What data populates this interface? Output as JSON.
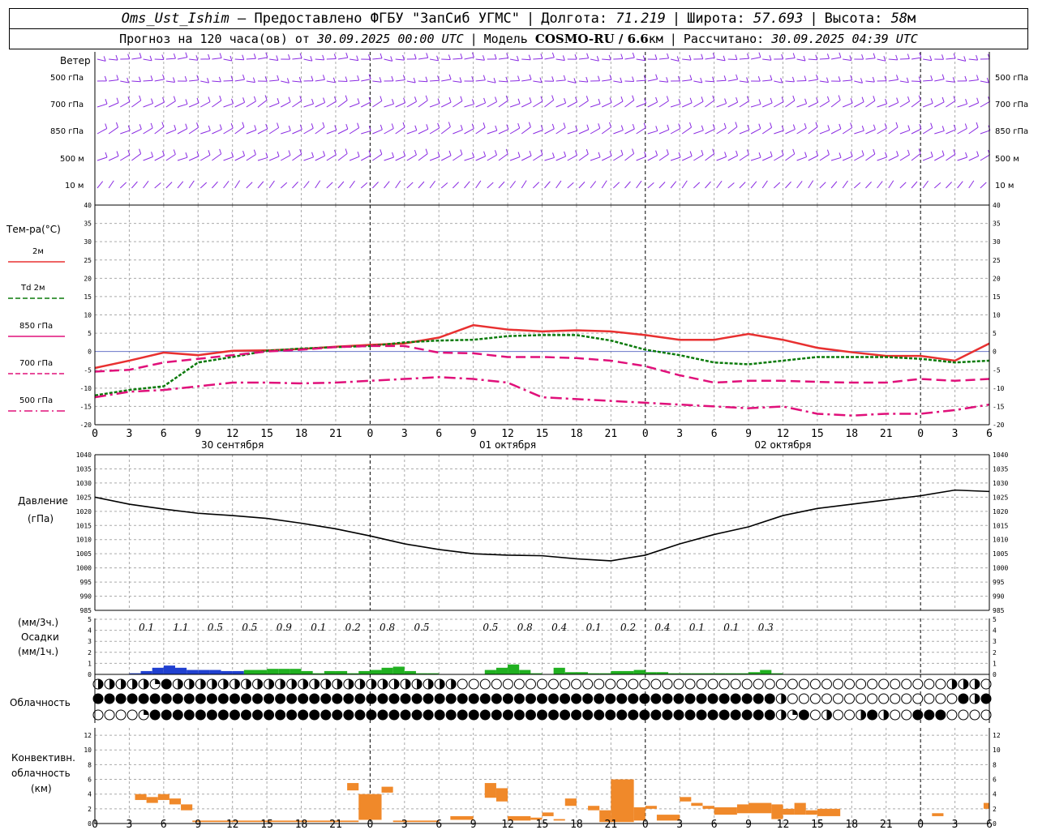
{
  "header": {
    "station": "Oms_Ust_Ishim",
    "provided": "– Предоставлено ФГБУ \"ЗапСиб УГМС\"",
    "lon_label": "Долгота:",
    "lon_value": "71.219",
    "lat_label": "Широта:",
    "lat_value": "57.693",
    "alt_label": "Высота:",
    "alt_value": "58",
    "alt_unit": "м",
    "forecast_prefix": "Прогноз на 120 часа(ов) от",
    "forecast_time": "30.09.2025 00:00 UTC",
    "model_label": "Модель",
    "model_name": "COSMO-RU / 6.6",
    "model_unit": "км",
    "calc_label": "Рассчитано:",
    "calc_time": "30.09.2025 04:39 UTC"
  },
  "wind_panel": {
    "title": "Ветер",
    "levels": [
      "500 гПа",
      "700 гПа",
      "850 гПа",
      "500 м",
      "10 м"
    ],
    "colors": {
      "barb": "#8a2be2",
      "stem": "#6a0dad"
    }
  },
  "temp_panel": {
    "title": "Тем-ра(°С)",
    "legend": [
      {
        "label": "2м",
        "color": "#e83030",
        "style": "solid"
      },
      {
        "label": "Td  2м",
        "color": "#0a7a0a",
        "style": "dashed"
      },
      {
        "label": "850 гПа",
        "color": "#e0107a",
        "style": "solid"
      },
      {
        "label": "700 гПа",
        "color": "#e0107a",
        "style": "dashed"
      },
      {
        "label": "500 гПа",
        "color": "#e0107a",
        "style": "dashdot"
      }
    ],
    "yticks": [
      "40",
      "35",
      "30",
      "25",
      "20",
      "15",
      "10",
      "5",
      "0",
      "-5",
      "-10",
      "-15",
      "-20"
    ]
  },
  "pressure_panel": {
    "title": "Давление",
    "unit": "(гПа)",
    "yticks": [
      "1040",
      "1035",
      "1030",
      "1025",
      "1020",
      "1015",
      "1010",
      "1005",
      "1000",
      "995",
      "990",
      "985"
    ]
  },
  "precip_panel": {
    "unit3": "(мм/3ч.)",
    "title": "Осадки",
    "unit1": "(мм/1ч.)",
    "yticks": [
      "5",
      "4",
      "3",
      "2",
      "1",
      "0"
    ],
    "totals": [
      "0.1",
      "1.1",
      "0.5",
      "0.5",
      "0.9",
      "0.1",
      "0.2",
      "0.8",
      "0.5",
      "0.5",
      "0.8",
      "0.4",
      "0.1",
      "0.2",
      "0.4",
      "0.1",
      "0.1",
      "0.3"
    ]
  },
  "cloud_panel": {
    "title": "Облачность"
  },
  "conv_panel": {
    "title1": "Конвективн.",
    "title2": "облачность",
    "title3": "(км)",
    "yticks": [
      "12",
      "10",
      "8",
      "6",
      "4",
      "2",
      "0"
    ]
  },
  "x_axis": {
    "ticks": [
      "0",
      "3",
      "6",
      "9",
      "12",
      "15",
      "18",
      "21",
      "0",
      "3",
      "6",
      "9",
      "12",
      "15",
      "18",
      "21",
      "0",
      "3",
      "6",
      "9",
      "12",
      "15",
      "18",
      "21",
      "0",
      "3",
      "6"
    ],
    "dates": [
      "30 сентября",
      "01 октября",
      "02 октября"
    ]
  },
  "chart_data": [
    {
      "type": "line",
      "title": "Тем-ра(°С)",
      "x_hours": [
        0,
        3,
        6,
        9,
        12,
        15,
        18,
        21,
        24,
        27,
        30,
        33,
        36,
        39,
        42,
        45,
        48,
        51,
        54,
        57,
        60,
        63,
        66,
        69,
        72,
        75,
        78
      ],
      "ylim": [
        -20,
        40
      ],
      "series": [
        {
          "name": "2м",
          "values": [
            -4.5,
            -2.5,
            -0.3,
            -1,
            0.2,
            0.3,
            0.7,
            1.3,
            1.8,
            2.2,
            3.8,
            7.2,
            6.0,
            5.5,
            5.8,
            5.5,
            4.5,
            3.2,
            3.2,
            4.8,
            3.2,
            1,
            -0.2,
            -1.2,
            -1.2,
            -2.5,
            2.2
          ]
        },
        {
          "name": "Td  2м",
          "values": [
            -12,
            -10.5,
            -9.5,
            -3,
            -1.5,
            0.2,
            0.8,
            1.2,
            1.5,
            2.5,
            3,
            3.2,
            4.2,
            4.5,
            4.5,
            3,
            0.5,
            -1,
            -3,
            -3.5,
            -2.5,
            -1.5,
            -1.5,
            -1.5,
            -2,
            -3,
            -2.5
          ]
        },
        {
          "name": "850 гПа",
          "values": [
            -5.5,
            -5,
            -3,
            -2,
            -1,
            0,
            0.5,
            1.2,
            1.5,
            1.5,
            -0.3,
            -0.5,
            -1.5,
            -1.5,
            -1.8,
            -2.5,
            -4,
            -6.5,
            -8.5,
            -8,
            -8,
            -8.3,
            -8.5,
            -8.5,
            -7.5,
            -8,
            -7.5
          ]
        },
        {
          "name": "700 гПа",
          "values": [
            -12.5,
            -11,
            -10.5,
            -9.5,
            -8.5,
            -8.5,
            -8.7,
            -8.5,
            -8,
            -7.5,
            -7,
            -7.5,
            -8.5,
            -12.5,
            -13,
            -13.5,
            -14,
            -14.5,
            -15,
            -15.5,
            -15,
            -17,
            -17.5,
            -17,
            -17,
            -16,
            -14.5
          ]
        },
        {
          "name": "500 гПа",
          "values": [
            -12.5,
            -11,
            -10.5,
            -9.5,
            -8.5,
            -8.5,
            -8.7,
            -8.5,
            -8,
            -7.5,
            -7,
            -7.5,
            -8.5,
            -12.5,
            -13,
            -13.5,
            -14,
            -14.5,
            -15,
            -15.5,
            -15,
            -17,
            -17.5,
            -17,
            -17,
            -16,
            -14.5
          ]
        }
      ]
    },
    {
      "type": "line",
      "title": "Давление",
      "x_hours": [
        0,
        3,
        6,
        9,
        12,
        15,
        18,
        21,
        24,
        27,
        30,
        33,
        36,
        39,
        42,
        45,
        48,
        51,
        54,
        57,
        60,
        63,
        66,
        69,
        72,
        75,
        78
      ],
      "ylim": [
        985,
        1040
      ],
      "series": [
        {
          "name": "Давление",
          "values": [
            1025,
            1022.5,
            1020.8,
            1019.3,
            1018.5,
            1017.5,
            1015.8,
            1013.8,
            1011.3,
            1008.5,
            1006.5,
            1005,
            1004.5,
            1004.3,
            1003.2,
            1002.5,
            1004.5,
            1008.5,
            1011.8,
            1014.5,
            1018.5,
            1021,
            1022.5,
            1024,
            1025.5,
            1027.5,
            1027
          ]
        }
      ]
    },
    {
      "type": "bar",
      "title": "Осадки",
      "x_hours": [
        3,
        4,
        5,
        6,
        7,
        8,
        9,
        10,
        11,
        12,
        13,
        14,
        15,
        16,
        17,
        18,
        19,
        20,
        21,
        22,
        23,
        24,
        25,
        26,
        27,
        28,
        29,
        34,
        35,
        36,
        37,
        38,
        40,
        41,
        42,
        43,
        44,
        45,
        46,
        47,
        48,
        49,
        50,
        51,
        52,
        53,
        54,
        55,
        56,
        57,
        58,
        59
      ],
      "ylim": [
        0,
        5
      ],
      "series": [
        {
          "name": "blue",
          "color": "#2040d0",
          "values": [
            0.1,
            0.3,
            0.6,
            0.8,
            0.6,
            0.4,
            0.4,
            0.4,
            0.3,
            0.3,
            0,
            0,
            0,
            0,
            0,
            0,
            0,
            0,
            0,
            0,
            0,
            0,
            0,
            0,
            0,
            0,
            0,
            0,
            0,
            0,
            0,
            0,
            0,
            0,
            0,
            0,
            0,
            0,
            0,
            0,
            0,
            0,
            0,
            0,
            0,
            0,
            0,
            0,
            0,
            0,
            0,
            0
          ]
        },
        {
          "name": "green",
          "color": "#20b020",
          "values": [
            0,
            0,
            0,
            0,
            0,
            0,
            0,
            0,
            0,
            0,
            0.4,
            0.4,
            0.5,
            0.5,
            0.5,
            0.3,
            0.1,
            0.3,
            0.3,
            0.1,
            0.3,
            0.4,
            0.6,
            0.7,
            0.3,
            0.1,
            0.1,
            0.4,
            0.6,
            0.9,
            0.4,
            0.1,
            0.6,
            0.2,
            0.2,
            0.1,
            0.1,
            0.3,
            0.3,
            0.4,
            0.2,
            0.2,
            0.1,
            0.1,
            0.1,
            0.1,
            0.1,
            0.1,
            0.1,
            0.2,
            0.4,
            0.1
          ]
        }
      ]
    },
    {
      "type": "bar",
      "title": "Конвективн. облачность (км)",
      "ylim": [
        0,
        13
      ],
      "segments": [
        {
          "from": 3.5,
          "to": 4.5,
          "base": 3.2,
          "top": 4
        },
        {
          "from": 4.5,
          "to": 5.5,
          "base": 2.8,
          "top": 3.6
        },
        {
          "from": 5.5,
          "to": 6.5,
          "base": 3.2,
          "top": 4
        },
        {
          "from": 6.5,
          "to": 7.5,
          "base": 2.6,
          "top": 3.4
        },
        {
          "from": 7.5,
          "to": 8.5,
          "base": 1.8,
          "top": 2.6
        },
        {
          "from": 8.5,
          "to": 23,
          "base": 0.2,
          "top": 0.4
        },
        {
          "from": 22,
          "to": 23,
          "base": 4.5,
          "top": 5.5
        },
        {
          "from": 23,
          "to": 25,
          "base": 0.5,
          "top": 4
        },
        {
          "from": 25,
          "to": 26,
          "base": 4.2,
          "top": 5
        },
        {
          "from": 26,
          "to": 30,
          "base": 0.2,
          "top": 0.4
        },
        {
          "from": 31,
          "to": 33,
          "base": 0.5,
          "top": 1
        },
        {
          "from": 34,
          "to": 35,
          "base": 3.5,
          "top": 5.5
        },
        {
          "from": 35,
          "to": 36,
          "base": 3,
          "top": 4.8
        },
        {
          "from": 36,
          "to": 38,
          "base": 0.4,
          "top": 1
        },
        {
          "from": 38,
          "to": 39,
          "base": 0.5,
          "top": 0.8
        },
        {
          "from": 39,
          "to": 40,
          "base": 1,
          "top": 1.5
        },
        {
          "from": 40,
          "to": 41,
          "base": 0.4,
          "top": 0.6
        },
        {
          "from": 41,
          "to": 42,
          "base": 2.4,
          "top": 3.4
        },
        {
          "from": 43,
          "to": 44,
          "base": 1.8,
          "top": 2.4
        },
        {
          "from": 44,
          "to": 45,
          "base": 0.2,
          "top": 1.8
        },
        {
          "from": 45,
          "to": 47,
          "base": 0.2,
          "top": 6
        },
        {
          "from": 47,
          "to": 48,
          "base": 0.4,
          "top": 2.2
        },
        {
          "from": 48,
          "to": 49,
          "base": 2,
          "top": 2.4
        },
        {
          "from": 49,
          "to": 51,
          "base": 0.4,
          "top": 1.2
        },
        {
          "from": 51,
          "to": 52,
          "base": 3,
          "top": 3.6
        },
        {
          "from": 52,
          "to": 53,
          "base": 2.4,
          "top": 2.8
        },
        {
          "from": 53,
          "to": 54,
          "base": 2,
          "top": 2.4
        },
        {
          "from": 54,
          "to": 56,
          "base": 1.2,
          "top": 2.2
        },
        {
          "from": 56,
          "to": 57,
          "base": 1.4,
          "top": 2.6
        },
        {
          "from": 57,
          "to": 59,
          "base": 1.4,
          "top": 2.8
        },
        {
          "from": 59,
          "to": 60,
          "base": 0.6,
          "top": 2.6
        },
        {
          "from": 60,
          "to": 61,
          "base": 1.2,
          "top": 2
        },
        {
          "from": 61,
          "to": 62,
          "base": 1.2,
          "top": 2.8
        },
        {
          "from": 62,
          "to": 63,
          "base": 1.2,
          "top": 1.8
        },
        {
          "from": 63,
          "to": 65,
          "base": 1,
          "top": 2
        },
        {
          "from": 73,
          "to": 74,
          "base": 1,
          "top": 1.4
        },
        {
          "from": 77.5,
          "to": 78,
          "base": 2,
          "top": 2.8
        }
      ]
    }
  ]
}
